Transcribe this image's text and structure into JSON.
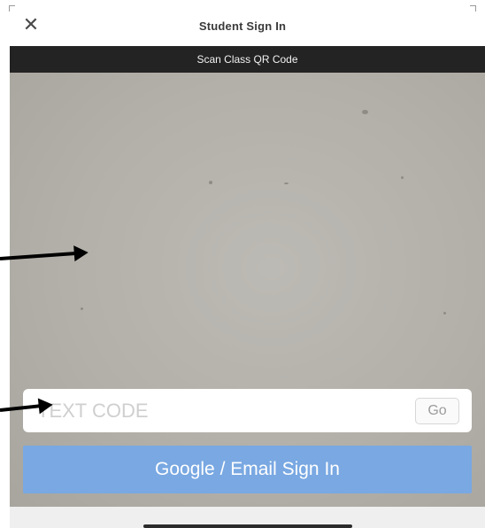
{
  "header": {
    "close_glyph": "✕",
    "title": "Student Sign In"
  },
  "scan_bar": {
    "label": "Scan Class QR Code"
  },
  "code_entry": {
    "placeholder": "TEXT CODE",
    "go_label": "Go"
  },
  "sign_in": {
    "label": "Google / Email Sign In"
  },
  "colors": {
    "accent": "#79a8e2",
    "scan_bar_bg": "#232323",
    "camera_bg": "#b3b0a9"
  },
  "icons": [
    "close-icon",
    "arrow-icon"
  ]
}
